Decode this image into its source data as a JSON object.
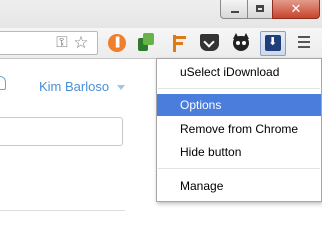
{
  "window": {
    "minimize_icon": "minimize-icon",
    "maximize_icon": "maximize-icon",
    "close_icon": "close-icon"
  },
  "toolbar": {
    "icons": [
      "key-icon",
      "star-icon",
      "orange-extension-icon",
      "green-extension-icon",
      "orange-t-extension-icon",
      "pocket-icon",
      "owl-icon",
      "uselect-idownload-icon",
      "hamburger-menu-icon"
    ]
  },
  "page": {
    "user_name": "Kim Barloso"
  },
  "context_menu": {
    "items": [
      {
        "label": "uSelect iDownload"
      },
      {
        "label": "Options"
      },
      {
        "label": "Remove from Chrome"
      },
      {
        "label": "Hide button"
      },
      {
        "label": "Manage"
      }
    ],
    "selected": "Options"
  },
  "colors": {
    "selection": "#4a7ddc",
    "link": "#4a90d9",
    "close_button": "#c8442c"
  }
}
